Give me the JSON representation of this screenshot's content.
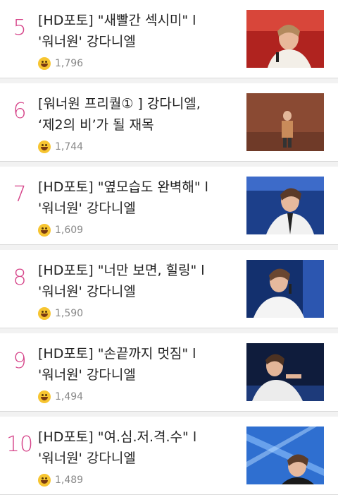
{
  "articles": [
    {
      "rank": "5",
      "title": "[HD포토] \"새빨간 섹시미\" l '워너원' 강다니엘",
      "count": "1,796",
      "thumb": "performer-photo-red-stage"
    },
    {
      "rank": "6",
      "title": "[워너원 프리퀄① ] 강다니엘, ‘제2의 비’가 될 재목",
      "count": "1,744",
      "thumb": "performer-photo-brown-stage"
    },
    {
      "rank": "7",
      "title": "[HD포토] \"옆모습도 완벽해\" l '워너원' 강다니엘",
      "count": "1,609",
      "thumb": "performer-photo-blue-stage"
    },
    {
      "rank": "8",
      "title": "[HD포토] \"너만 보면, 힐링\" l '워너원' 강다니엘",
      "count": "1,590",
      "thumb": "performer-photo-blue-stage"
    },
    {
      "rank": "9",
      "title": "[HD포토] \"손끝까지 멋짐\" l '워너원' 강다니엘",
      "count": "1,494",
      "thumb": "performer-photo-dark-stage"
    },
    {
      "rank": "10",
      "title": "[HD포토] \"여.심.저.격.수\" l '워너원' 강다니엘",
      "count": "1,489",
      "thumb": "performer-photo-light-blue-stage"
    }
  ],
  "colors": {
    "rank": "#d6458a",
    "title": "#222222",
    "count": "#888888",
    "emoji": "#f7c531"
  },
  "icons": {
    "reaction": "smile-emoji-icon"
  }
}
